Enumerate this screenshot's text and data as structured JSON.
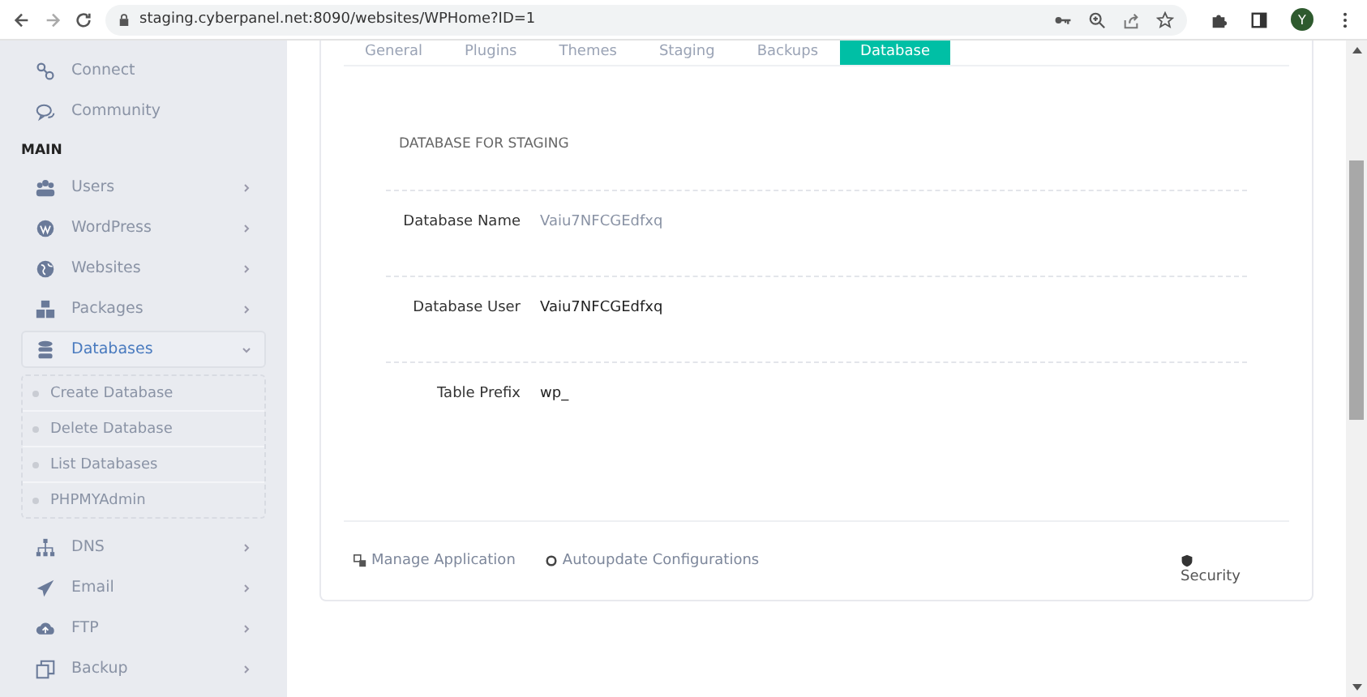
{
  "browser": {
    "url": "staging.cyberpanel.net:8090/websites/WPHome?ID=1",
    "avatar": "Y"
  },
  "sidebar": {
    "items": [
      {
        "kind": "link",
        "label": "Connect"
      },
      {
        "kind": "link",
        "label": "Community"
      },
      {
        "kind": "header",
        "label": "MAIN"
      },
      {
        "kind": "menu",
        "label": "Users",
        "expanded": false
      },
      {
        "kind": "menu",
        "label": "WordPress",
        "expanded": false
      },
      {
        "kind": "menu",
        "label": "Websites",
        "expanded": false
      },
      {
        "kind": "menu",
        "label": "Packages",
        "expanded": false
      },
      {
        "kind": "menu",
        "label": "Databases",
        "expanded": true,
        "children": [
          {
            "label": "Create Database"
          },
          {
            "label": "Delete Database"
          },
          {
            "label": "List Databases"
          },
          {
            "label": "PHPMYAdmin"
          }
        ]
      },
      {
        "kind": "menu",
        "label": "DNS",
        "expanded": false
      },
      {
        "kind": "menu",
        "label": "Email",
        "expanded": false
      },
      {
        "kind": "menu",
        "label": "FTP",
        "expanded": false
      },
      {
        "kind": "menu",
        "label": "Backup",
        "expanded": false
      }
    ]
  },
  "tabs": [
    {
      "label": "General",
      "selected": false
    },
    {
      "label": "Plugins",
      "selected": false
    },
    {
      "label": "Themes",
      "selected": false
    },
    {
      "label": "Staging",
      "selected": false
    },
    {
      "label": "Backups",
      "selected": false
    },
    {
      "label": "Database",
      "selected": true
    }
  ],
  "section_title": "DATABASE FOR STAGING",
  "fields": [
    {
      "label": "Database Name",
      "value": "Vaiu7NFCGEdfxq",
      "muted": true
    },
    {
      "label": "Database User",
      "value": "Vaiu7NFCGEdfxq",
      "muted": false
    },
    {
      "label": "Table Prefix",
      "value": "wp_",
      "muted": false
    }
  ],
  "footer_links": [
    {
      "label": "Manage Application"
    },
    {
      "label": "Autoupdate Configurations"
    },
    {
      "label": "Security"
    }
  ]
}
